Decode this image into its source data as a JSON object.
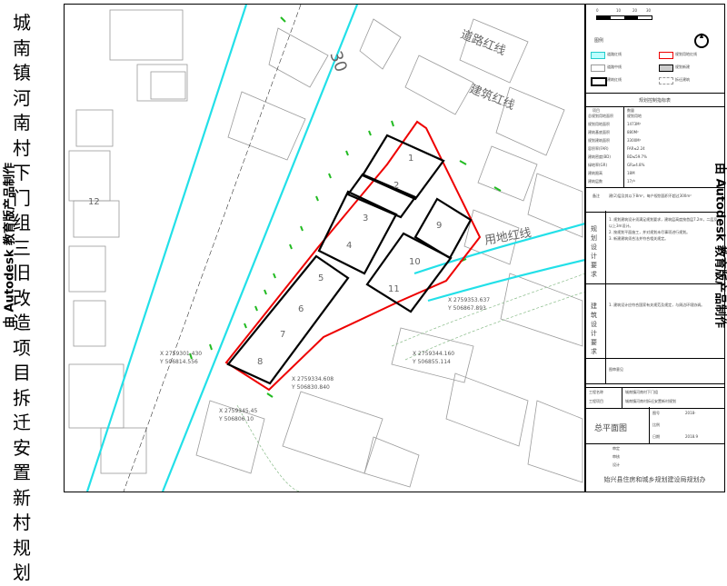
{
  "vertical_title": "城南镇河南村下门组三旧改造项目拆迁安置新村规划",
  "side_text_left": "由 Autodesk 教育版产品制作",
  "side_text_right": "由 Autodesk 教育版产品制作",
  "map": {
    "road_numbers": [
      "30"
    ],
    "road_labels": [
      "道路红线",
      "建筑红线",
      "用地红线"
    ],
    "lot_numbers": [
      "1",
      "2",
      "3",
      "4",
      "5",
      "6",
      "7",
      "8",
      "9",
      "10",
      "11"
    ],
    "parcel_number": "12",
    "coordinates": [
      {
        "x": "X 2759353.637",
        "y": "Y 506867.893"
      },
      {
        "x": "X 2759344.160",
        "y": "Y 506855.114"
      },
      {
        "x": "X 2759334.608",
        "y": "Y 506830.840"
      },
      {
        "x": "X 2759301.430",
        "y": "Y 506814.556"
      },
      {
        "x": "X 2759345.45",
        "y": "Y 506806.10"
      }
    ]
  },
  "panel": {
    "scale_ticks": [
      "0",
      "10",
      "20",
      "30"
    ],
    "legend_title": "图例",
    "legend_items": [
      "道路红线",
      "规划用地红线",
      "道路中线",
      "规划新建",
      "建筑红线",
      "拆迁建筑"
    ],
    "table_title": "规划控制指标表",
    "table_header": [
      "项目",
      "数量"
    ],
    "table_rows": [
      [
        "总规划用地面积",
        "规划用地"
      ],
      [
        "规划用地面积",
        "1473M²"
      ],
      [
        "建筑基底面积",
        "880M²"
      ],
      [
        "规划建筑面积",
        "3300M²"
      ],
      [
        "容积率(FAR)",
        "FAR≤2.24"
      ],
      [
        "建筑密度(BD)",
        "BD≤59.7%"
      ],
      [
        "绿地率(GR)",
        "GR≥4.8%"
      ],
      [
        "建筑限高",
        "18M"
      ],
      [
        "建筑层数",
        "17户"
      ]
    ],
    "remark_label": "备注",
    "remark_text": "建(2)层及其以下8m²，每户规划面积不超过300m²",
    "sections": [
      {
        "label": "规划设计要求",
        "text": "1. 规划建筑设计须满足规划要求，建筑层高度按首层7.2m，二层及以上3m设计。\n2. 按规划平面施工，并对规划未尽事项进行规划。\n3. 新建建筑须合法并符合相关规定。"
      },
      {
        "label": "建筑设计要求",
        "text": "1. 建筑设计应符合国家有关规范及规定，与周边环境协调。"
      },
      {
        "label": "",
        "text": "图审意见"
      }
    ],
    "signoff_rows": [
      [
        "工程名称",
        "城南镇河南村下门组"
      ],
      [
        "工程项目",
        "城南镇河南村拆迁安置新村规划"
      ]
    ],
    "drawing_name": "总平面图",
    "meta_rows": [
      [
        "图号",
        "2018-"
      ],
      [
        "比例",
        ""
      ],
      [
        "日期",
        "2018.9"
      ]
    ],
    "role_rows": [
      "审定",
      "审核",
      "设计"
    ],
    "org": "始兴县住房和城乡规划建设局规划办"
  }
}
